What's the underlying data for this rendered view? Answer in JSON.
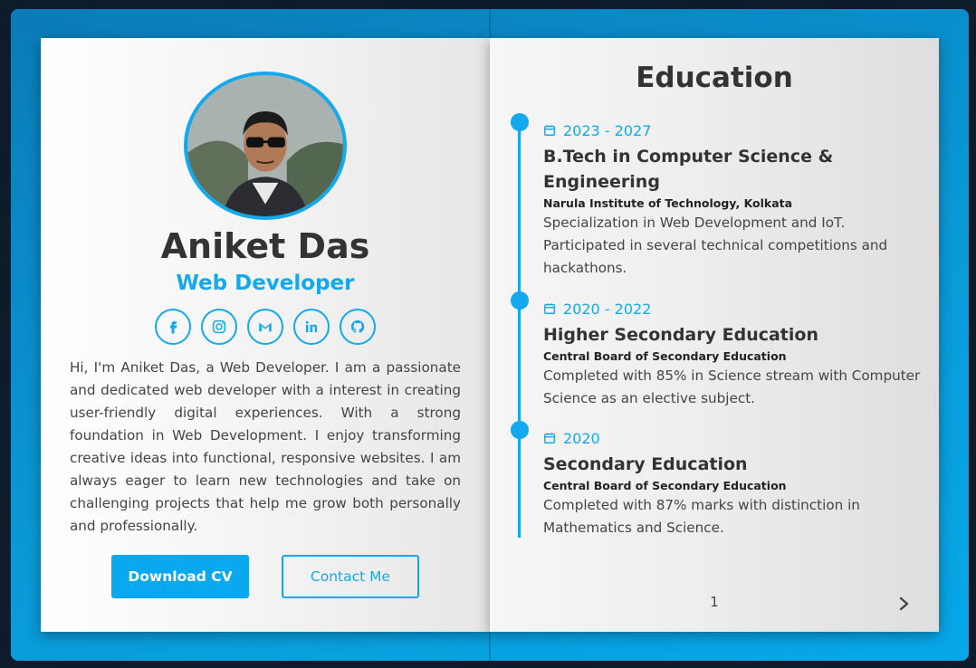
{
  "profile": {
    "name": "Aniket Das",
    "role": "Web Developer",
    "bio": "Hi, I'm Aniket Das, a Web Developer. I am a passionate and dedicated web developer with a interest in creating user-friendly digital experiences. With a strong foundation in Web Development. I enjoy transforming creative ideas into functional, responsive websites. I am always eager to learn new technologies and take on challenging projects that help me grow both personally and professionally."
  },
  "socials": [
    {
      "icon": "facebook-icon"
    },
    {
      "icon": "instagram-icon"
    },
    {
      "icon": "gmail-icon"
    },
    {
      "icon": "linkedin-icon"
    },
    {
      "icon": "github-icon"
    }
  ],
  "buttons": {
    "download_cv": "Download CV",
    "contact_me": "Contact Me"
  },
  "education": {
    "title": "Education",
    "entries": [
      {
        "date": "2023 - 2027",
        "degree": "B.Tech in Computer Science & Engineering",
        "school": "Narula Institute of Technology, Kolkata",
        "description": "Specialization in Web Development and IoT. Participated in several technical competitions and hackathons."
      },
      {
        "date": "2020 - 2022",
        "degree": "Higher Secondary Education",
        "school": "Central Board of Secondary Education",
        "description": "Completed with 85% in Science stream with Computer Science as an elective subject."
      },
      {
        "date": "2020",
        "degree": "Secondary Education",
        "school": "Central Board of Secondary Education",
        "description": "Completed with 87% marks with distinction in Mathematics and Science."
      }
    ]
  },
  "pagination": {
    "page_number": "1",
    "next_icon": "chevron-right-icon"
  },
  "colors": {
    "accent": "#12a9ee",
    "text_dark": "#333333",
    "background": "#0d1b2a"
  }
}
